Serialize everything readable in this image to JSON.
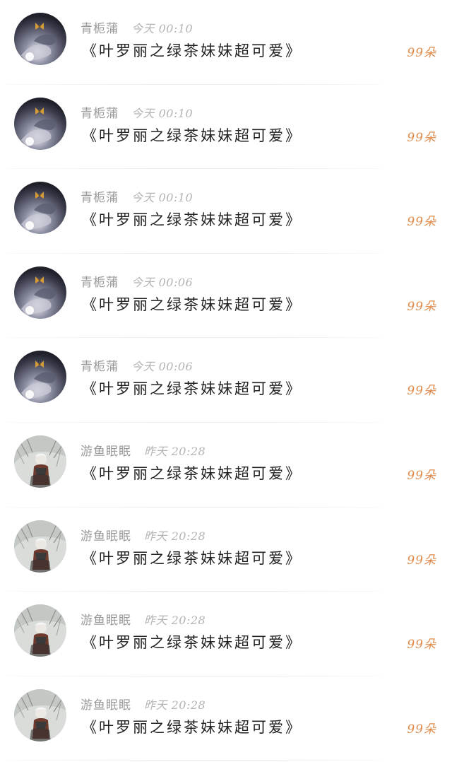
{
  "avatars": {
    "a": "hand-holding-butterfly-avatar",
    "b": "winter-girl-avatar"
  },
  "colors": {
    "name": "#9a9a9a",
    "time": "#b4b4b4",
    "content": "#222222",
    "gift": "#e08a4a",
    "background": "#ffffff"
  },
  "items": [
    {
      "avatar": "a",
      "name": "青栀蒲",
      "time": "今天 00:10",
      "content": "《叶罗丽之绿茶妹妹超可爱》",
      "gift": "99朵"
    },
    {
      "avatar": "a",
      "name": "青栀蒲",
      "time": "今天 00:10",
      "content": "《叶罗丽之绿茶妹妹超可爱》",
      "gift": "99朵"
    },
    {
      "avatar": "a",
      "name": "青栀蒲",
      "time": "今天 00:10",
      "content": "《叶罗丽之绿茶妹妹超可爱》",
      "gift": "99朵"
    },
    {
      "avatar": "a",
      "name": "青栀蒲",
      "time": "今天 00:06",
      "content": "《叶罗丽之绿茶妹妹超可爱》",
      "gift": "99朵"
    },
    {
      "avatar": "a",
      "name": "青栀蒲",
      "time": "今天 00:06",
      "content": "《叶罗丽之绿茶妹妹超可爱》",
      "gift": "99朵"
    },
    {
      "avatar": "b",
      "name": "游鱼眠眠",
      "time": "昨天 20:28",
      "content": "《叶罗丽之绿茶妹妹超可爱》",
      "gift": "99朵"
    },
    {
      "avatar": "b",
      "name": "游鱼眠眠",
      "time": "昨天 20:28",
      "content": "《叶罗丽之绿茶妹妹超可爱》",
      "gift": "99朵"
    },
    {
      "avatar": "b",
      "name": "游鱼眠眠",
      "time": "昨天 20:28",
      "content": "《叶罗丽之绿茶妹妹超可爱》",
      "gift": "99朵"
    },
    {
      "avatar": "b",
      "name": "游鱼眠眠",
      "time": "昨天 20:28",
      "content": "《叶罗丽之绿茶妹妹超可爱》",
      "gift": "99朵"
    }
  ]
}
